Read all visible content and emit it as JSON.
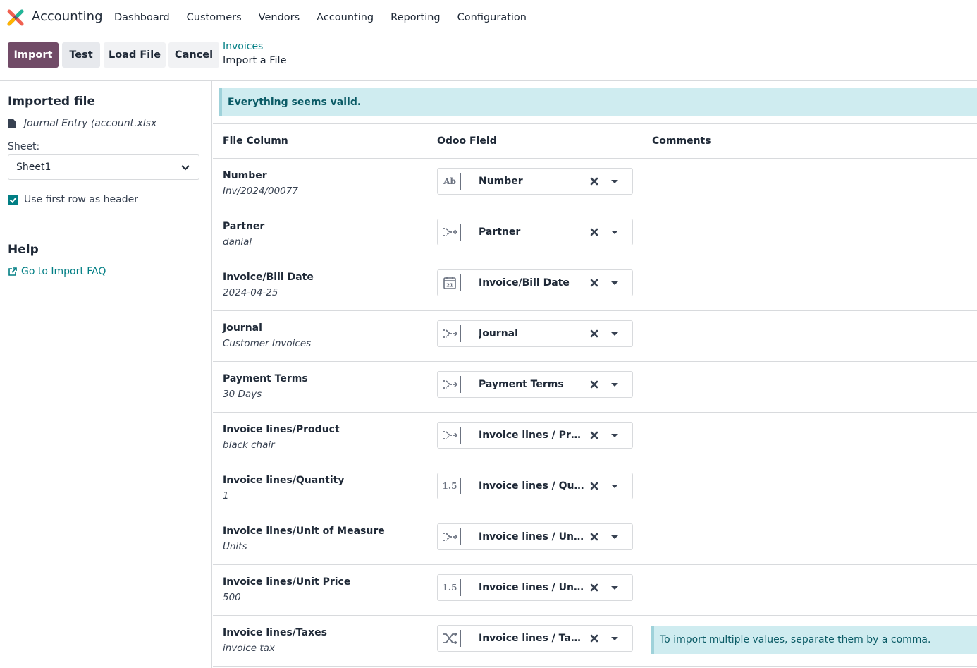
{
  "navbar": {
    "app_name": "Accounting",
    "items": [
      "Dashboard",
      "Customers",
      "Vendors",
      "Accounting",
      "Reporting",
      "Configuration"
    ]
  },
  "control": {
    "buttons": {
      "import": "Import",
      "test": "Test",
      "load_file": "Load File",
      "cancel": "Cancel"
    },
    "breadcrumb": "Invoices",
    "subtitle": "Import a File"
  },
  "sidebar": {
    "imported_title": "Imported file",
    "file_name": "Journal Entry (account.xlsx",
    "sheet_label": "Sheet:",
    "sheet_value": "Sheet1",
    "header_checkbox_label": "Use first row as header",
    "header_checked": true,
    "help_title": "Help",
    "faq_link": "Go to Import FAQ"
  },
  "main": {
    "alert": "Everything seems valid.",
    "headers": {
      "file_column": "File Column",
      "odoo_field": "Odoo Field",
      "comments": "Comments"
    },
    "rows": [
      {
        "name": "Number",
        "sample": "Inv/2024/00077",
        "field": "Number",
        "icon": "text-icon",
        "comment": ""
      },
      {
        "name": "Partner",
        "sample": "danial",
        "field": "Partner",
        "icon": "relation-icon",
        "comment": ""
      },
      {
        "name": "Invoice/Bill Date",
        "sample": "2024-04-25",
        "field": "Invoice/Bill Date",
        "icon": "calendar-icon",
        "comment": ""
      },
      {
        "name": "Journal",
        "sample": "Customer Invoices",
        "field": "Journal",
        "icon": "relation-icon",
        "comment": ""
      },
      {
        "name": "Payment Terms",
        "sample": "30 Days",
        "field": "Payment Terms",
        "icon": "relation-icon",
        "comment": ""
      },
      {
        "name": "Invoice lines/Product",
        "sample": "black chair",
        "field": "Invoice lines / Product",
        "icon": "relation-icon",
        "comment": ""
      },
      {
        "name": "Invoice lines/Quantity",
        "sample": "1",
        "field": "Invoice lines / Quantity",
        "icon": "float-icon",
        "comment": ""
      },
      {
        "name": "Invoice lines/Unit of Measure",
        "sample": "Units",
        "field": "Invoice lines / Unit of Measure",
        "icon": "relation-icon",
        "comment": ""
      },
      {
        "name": "Invoice lines/Unit Price",
        "sample": "500",
        "field": "Invoice lines / Unit Price",
        "icon": "float-icon",
        "comment": ""
      },
      {
        "name": "Invoice lines/Taxes",
        "sample": "invoice tax",
        "field": "Invoice lines / Taxes",
        "icon": "many2many-icon",
        "comment": "To import multiple values, separate them by a comma."
      }
    ]
  },
  "colors": {
    "primary": "#714b67",
    "link": "#017e84",
    "alert_bg": "#cfecf0",
    "alert_text": "#0b5b66"
  }
}
